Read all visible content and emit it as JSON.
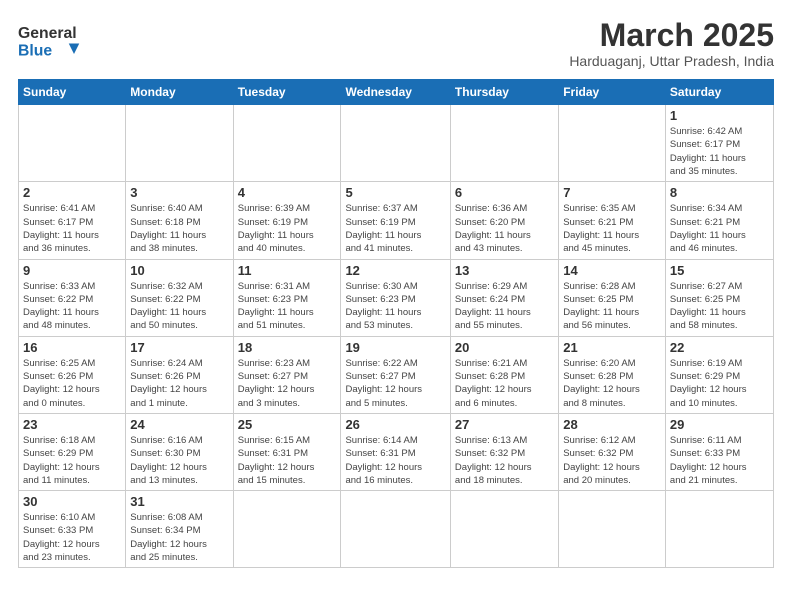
{
  "header": {
    "logo_general": "General",
    "logo_blue": "Blue",
    "month_year": "March 2025",
    "location": "Harduaganj, Uttar Pradesh, India"
  },
  "weekdays": [
    "Sunday",
    "Monday",
    "Tuesday",
    "Wednesday",
    "Thursday",
    "Friday",
    "Saturday"
  ],
  "days": [
    {
      "date": "",
      "info": ""
    },
    {
      "date": "",
      "info": ""
    },
    {
      "date": "",
      "info": ""
    },
    {
      "date": "",
      "info": ""
    },
    {
      "date": "",
      "info": ""
    },
    {
      "date": "",
      "info": ""
    },
    {
      "date": "1",
      "info": "Sunrise: 6:42 AM\nSunset: 6:17 PM\nDaylight: 11 hours\nand 35 minutes."
    },
    {
      "date": "2",
      "info": "Sunrise: 6:41 AM\nSunset: 6:17 PM\nDaylight: 11 hours\nand 36 minutes."
    },
    {
      "date": "3",
      "info": "Sunrise: 6:40 AM\nSunset: 6:18 PM\nDaylight: 11 hours\nand 38 minutes."
    },
    {
      "date": "4",
      "info": "Sunrise: 6:39 AM\nSunset: 6:19 PM\nDaylight: 11 hours\nand 40 minutes."
    },
    {
      "date": "5",
      "info": "Sunrise: 6:37 AM\nSunset: 6:19 PM\nDaylight: 11 hours\nand 41 minutes."
    },
    {
      "date": "6",
      "info": "Sunrise: 6:36 AM\nSunset: 6:20 PM\nDaylight: 11 hours\nand 43 minutes."
    },
    {
      "date": "7",
      "info": "Sunrise: 6:35 AM\nSunset: 6:21 PM\nDaylight: 11 hours\nand 45 minutes."
    },
    {
      "date": "8",
      "info": "Sunrise: 6:34 AM\nSunset: 6:21 PM\nDaylight: 11 hours\nand 46 minutes."
    },
    {
      "date": "9",
      "info": "Sunrise: 6:33 AM\nSunset: 6:22 PM\nDaylight: 11 hours\nand 48 minutes."
    },
    {
      "date": "10",
      "info": "Sunrise: 6:32 AM\nSunset: 6:22 PM\nDaylight: 11 hours\nand 50 minutes."
    },
    {
      "date": "11",
      "info": "Sunrise: 6:31 AM\nSunset: 6:23 PM\nDaylight: 11 hours\nand 51 minutes."
    },
    {
      "date": "12",
      "info": "Sunrise: 6:30 AM\nSunset: 6:23 PM\nDaylight: 11 hours\nand 53 minutes."
    },
    {
      "date": "13",
      "info": "Sunrise: 6:29 AM\nSunset: 6:24 PM\nDaylight: 11 hours\nand 55 minutes."
    },
    {
      "date": "14",
      "info": "Sunrise: 6:28 AM\nSunset: 6:25 PM\nDaylight: 11 hours\nand 56 minutes."
    },
    {
      "date": "15",
      "info": "Sunrise: 6:27 AM\nSunset: 6:25 PM\nDaylight: 11 hours\nand 58 minutes."
    },
    {
      "date": "16",
      "info": "Sunrise: 6:25 AM\nSunset: 6:26 PM\nDaylight: 12 hours\nand 0 minutes."
    },
    {
      "date": "17",
      "info": "Sunrise: 6:24 AM\nSunset: 6:26 PM\nDaylight: 12 hours\nand 1 minute."
    },
    {
      "date": "18",
      "info": "Sunrise: 6:23 AM\nSunset: 6:27 PM\nDaylight: 12 hours\nand 3 minutes."
    },
    {
      "date": "19",
      "info": "Sunrise: 6:22 AM\nSunset: 6:27 PM\nDaylight: 12 hours\nand 5 minutes."
    },
    {
      "date": "20",
      "info": "Sunrise: 6:21 AM\nSunset: 6:28 PM\nDaylight: 12 hours\nand 6 minutes."
    },
    {
      "date": "21",
      "info": "Sunrise: 6:20 AM\nSunset: 6:28 PM\nDaylight: 12 hours\nand 8 minutes."
    },
    {
      "date": "22",
      "info": "Sunrise: 6:19 AM\nSunset: 6:29 PM\nDaylight: 12 hours\nand 10 minutes."
    },
    {
      "date": "23",
      "info": "Sunrise: 6:18 AM\nSunset: 6:29 PM\nDaylight: 12 hours\nand 11 minutes."
    },
    {
      "date": "24",
      "info": "Sunrise: 6:16 AM\nSunset: 6:30 PM\nDaylight: 12 hours\nand 13 minutes."
    },
    {
      "date": "25",
      "info": "Sunrise: 6:15 AM\nSunset: 6:31 PM\nDaylight: 12 hours\nand 15 minutes."
    },
    {
      "date": "26",
      "info": "Sunrise: 6:14 AM\nSunset: 6:31 PM\nDaylight: 12 hours\nand 16 minutes."
    },
    {
      "date": "27",
      "info": "Sunrise: 6:13 AM\nSunset: 6:32 PM\nDaylight: 12 hours\nand 18 minutes."
    },
    {
      "date": "28",
      "info": "Sunrise: 6:12 AM\nSunset: 6:32 PM\nDaylight: 12 hours\nand 20 minutes."
    },
    {
      "date": "29",
      "info": "Sunrise: 6:11 AM\nSunset: 6:33 PM\nDaylight: 12 hours\nand 21 minutes."
    },
    {
      "date": "30",
      "info": "Sunrise: 6:10 AM\nSunset: 6:33 PM\nDaylight: 12 hours\nand 23 minutes."
    },
    {
      "date": "31",
      "info": "Sunrise: 6:08 AM\nSunset: 6:34 PM\nDaylight: 12 hours\nand 25 minutes."
    },
    {
      "date": "",
      "info": ""
    },
    {
      "date": "",
      "info": ""
    },
    {
      "date": "",
      "info": ""
    },
    {
      "date": "",
      "info": ""
    },
    {
      "date": "",
      "info": ""
    }
  ]
}
